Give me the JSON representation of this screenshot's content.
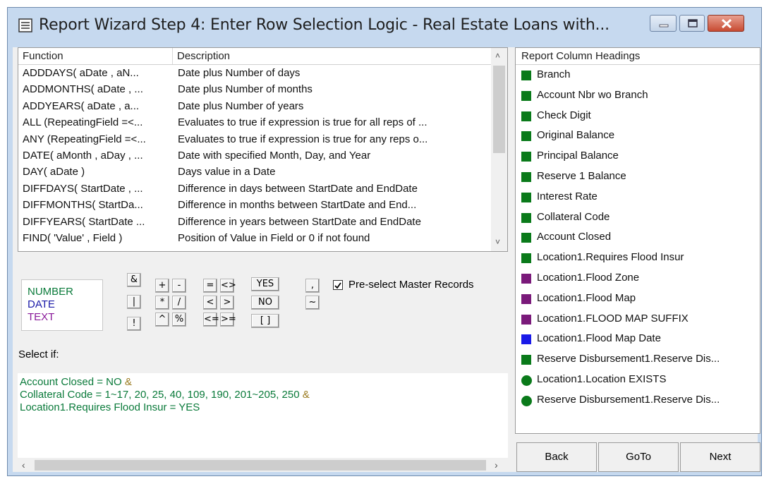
{
  "window": {
    "title": "Report Wizard Step 4:  Enter Row Selection Logic - Real Estate Loans with...",
    "title_icon": "document-list-icon"
  },
  "function_list": {
    "headers": {
      "function": "Function",
      "description": "Description"
    },
    "rows": [
      {
        "function": "ADDDAYS( aDate , aN...",
        "description": "Date plus Number of days"
      },
      {
        "function": "ADDMONTHS( aDate , ...",
        "description": "Date plus Number of months"
      },
      {
        "function": "ADDYEARS( aDate , a...",
        "description": "Date plus Number of years"
      },
      {
        "function": "ALL (RepeatingField =<...",
        "description": "Evaluates to true if expression is true for all reps of ..."
      },
      {
        "function": "ANY (RepeatingField =<...",
        "description": "Evaluates to true if expression is true for any reps o..."
      },
      {
        "function": "DATE( aMonth , aDay , ...",
        "description": "Date with specified Month, Day, and Year"
      },
      {
        "function": "DAY( aDate )",
        "description": "Days value in a Date"
      },
      {
        "function": "DIFFDAYS( StartDate , ...",
        "description": "Difference in days between StartDate and EndDate"
      },
      {
        "function": "DIFFMONTHS( StartDa...",
        "description": "Difference in months between StartDate and End..."
      },
      {
        "function": "DIFFYEARS( StartDate ...",
        "description": "Difference in years between StartDate and EndDate"
      },
      {
        "function": "FIND( 'Value' , Field )",
        "description": "Position of Value in Field or 0 if not found"
      }
    ]
  },
  "legend": {
    "number": "NUMBER",
    "date": "DATE",
    "text": "TEXT",
    "colors": {
      "number": "#0a7a3a",
      "date": "#1a1aa8",
      "text": "#8a1a9a"
    }
  },
  "operators": {
    "amp": "&",
    "pipe": "|",
    "bang": "!",
    "plus": "+",
    "minus": "-",
    "times": "*",
    "divide": "/",
    "caret": "^",
    "percent": "%",
    "eq": "=",
    "ne": "<>",
    "lt": "<",
    "gt": ">",
    "le": "<=",
    "ge": ">=",
    "yes": "YES",
    "no": "NO",
    "brackets": "[  ]",
    "comma": ",",
    "tilde": "~"
  },
  "preselect": {
    "label": "Pre-select Master Records",
    "checked": true
  },
  "select_if_label": "Select if:",
  "logic": {
    "line1": "Account Closed = NO ",
    "line1_op": "&",
    "line2": "Collateral Code = 1~17, 20, 25, 40, 109, 190, 201~205, 250 ",
    "line2_op": "&",
    "line3": "Location1.Requires Flood Insur = YES"
  },
  "column_headings": {
    "header": "Report Column Headings",
    "items": [
      {
        "label": "Branch",
        "color": "#0a7a1a",
        "shape": "square"
      },
      {
        "label": "Account Nbr wo Branch",
        "color": "#0a7a1a",
        "shape": "square"
      },
      {
        "label": "Check Digit",
        "color": "#0a7a1a",
        "shape": "square"
      },
      {
        "label": "Original Balance",
        "color": "#0a7a1a",
        "shape": "square"
      },
      {
        "label": "Principal Balance",
        "color": "#0a7a1a",
        "shape": "square"
      },
      {
        "label": "Reserve 1 Balance",
        "color": "#0a7a1a",
        "shape": "square"
      },
      {
        "label": "Interest Rate",
        "color": "#0a7a1a",
        "shape": "square"
      },
      {
        "label": "Collateral Code",
        "color": "#0a7a1a",
        "shape": "square"
      },
      {
        "label": "Account Closed",
        "color": "#0a7a1a",
        "shape": "square"
      },
      {
        "label": "Location1.Requires Flood Insur",
        "color": "#0a7a1a",
        "shape": "square"
      },
      {
        "label": "Location1.Flood Zone",
        "color": "#7a1a7a",
        "shape": "square"
      },
      {
        "label": "Location1.Flood Map",
        "color": "#7a1a7a",
        "shape": "square"
      },
      {
        "label": "Location1.FLOOD MAP SUFFIX",
        "color": "#7a1a7a",
        "shape": "square"
      },
      {
        "label": "Location1.Flood Map Date",
        "color": "#1a1ae8",
        "shape": "square"
      },
      {
        "label": "Reserve Disbursement1.Reserve Dis...",
        "color": "#0a7a1a",
        "shape": "square"
      },
      {
        "label": "Location1.Location EXISTS",
        "color": "#0a7a1a",
        "shape": "circle"
      },
      {
        "label": "Reserve Disbursement1.Reserve Dis...",
        "color": "#0a7a1a",
        "shape": "circle"
      }
    ]
  },
  "nav": {
    "back": "Back",
    "goto": "GoTo",
    "next": "Next"
  }
}
